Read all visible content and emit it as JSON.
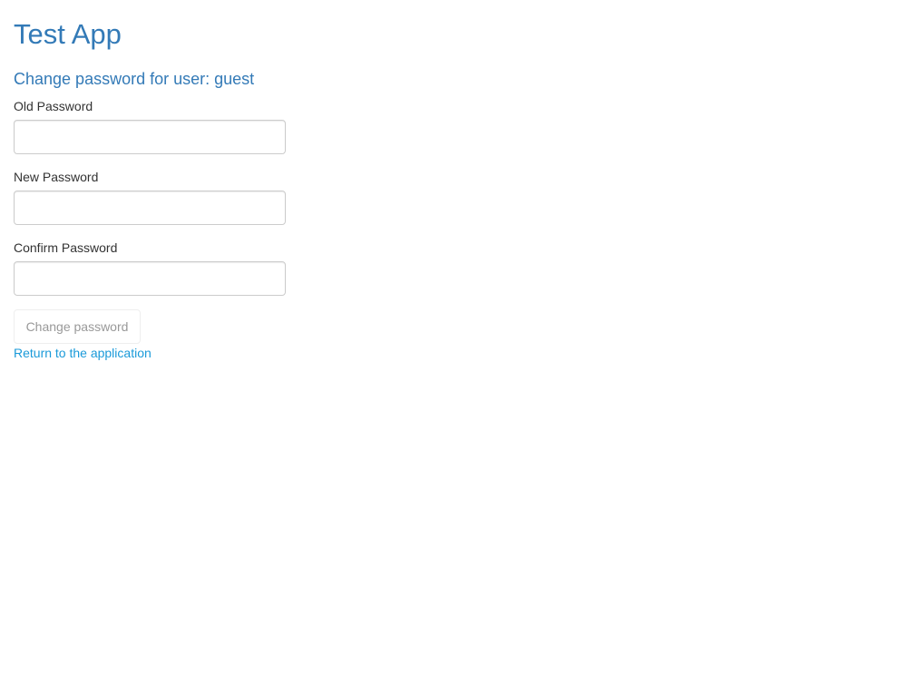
{
  "app": {
    "title": "Test App"
  },
  "form": {
    "heading": "Change password for user: guest",
    "fields": [
      {
        "label": "Old Password",
        "value": "",
        "placeholder": ""
      },
      {
        "label": "New Password",
        "value": "",
        "placeholder": ""
      },
      {
        "label": "Confirm Password",
        "value": "",
        "placeholder": ""
      }
    ],
    "submit_label": "Change password",
    "return_link_label": "Return to the application"
  },
  "colors": {
    "heading": "#337ab7",
    "link": "#1a9ad9",
    "disabled_text": "#999999",
    "input_border": "#cccccc"
  }
}
